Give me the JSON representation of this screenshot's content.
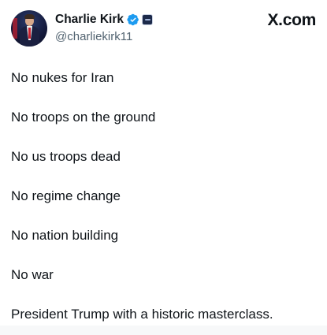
{
  "author": {
    "display_name": "Charlie Kirk",
    "handle": "@charliekirk11",
    "verified": true,
    "avatar_icon": "profile-photo",
    "badge_icons": [
      "verified-badge-icon",
      "affiliate-badge-icon"
    ]
  },
  "brand": {
    "label": "X.com"
  },
  "tweet": {
    "lines": [
      "No nukes for Iran",
      "No troops on the ground",
      "No us troops dead",
      "No regime change",
      "No nation building",
      "No war",
      "President Trump with a historic masterclass."
    ]
  },
  "colors": {
    "text_primary": "#0f1419",
    "text_secondary": "#536471",
    "verified_blue": "#1d9bf0",
    "background": "#ffffff"
  }
}
